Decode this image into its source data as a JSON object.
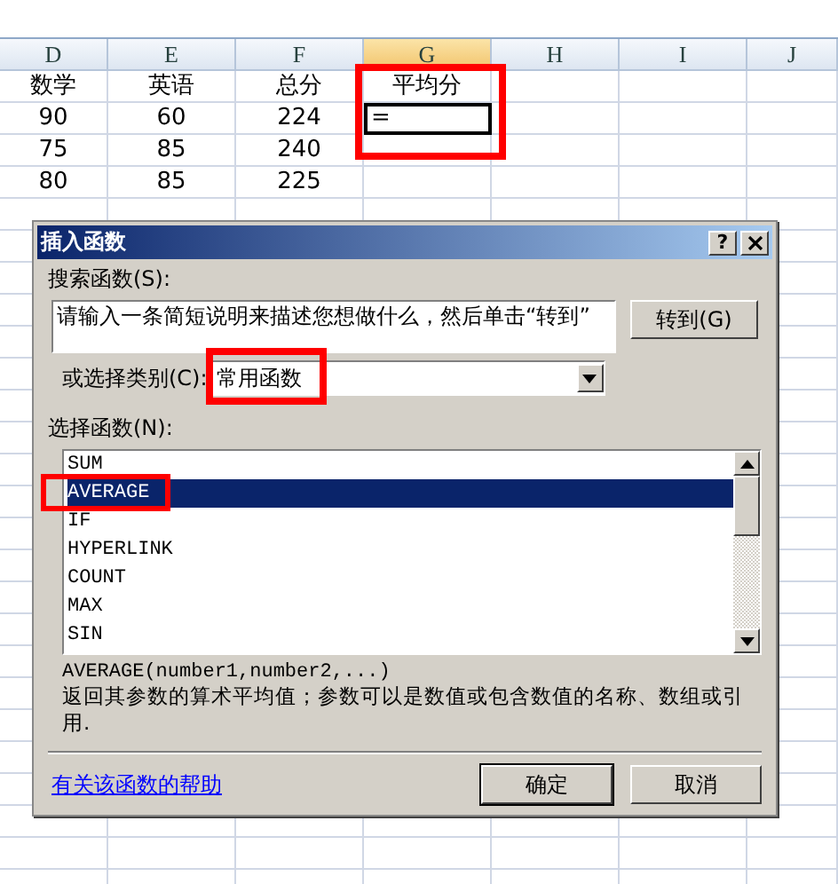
{
  "sheet": {
    "columns": [
      {
        "label": "D",
        "selected": false
      },
      {
        "label": "E",
        "selected": false
      },
      {
        "label": "F",
        "selected": false
      },
      {
        "label": "G",
        "selected": true
      },
      {
        "label": "H",
        "selected": false
      },
      {
        "label": "I",
        "selected": false
      },
      {
        "label": "J",
        "selected": false
      }
    ],
    "rows": [
      {
        "cells": [
          {
            "text": "数学",
            "selected": false
          },
          {
            "text": "英语",
            "selected": false
          },
          {
            "text": "总分",
            "selected": false
          },
          {
            "text": "平均分",
            "selected": false
          }
        ]
      },
      {
        "cells": [
          {
            "text": "90",
            "selected": false
          },
          {
            "text": "60",
            "selected": false
          },
          {
            "text": "224",
            "selected": false
          },
          {
            "text": "=",
            "selected": true
          }
        ]
      },
      {
        "cells": [
          {
            "text": "75",
            "selected": false
          },
          {
            "text": "85",
            "selected": false
          },
          {
            "text": "240",
            "selected": false
          }
        ]
      },
      {
        "cells": [
          {
            "text": "80",
            "selected": false
          },
          {
            "text": "85",
            "selected": false
          },
          {
            "text": "225",
            "selected": false
          }
        ]
      }
    ]
  },
  "dialog": {
    "title": "插入函数",
    "help_button": "?",
    "search_label": "搜索函数(S):",
    "search_field": {
      "value": "请输入一条简短说明来描述您想做什么，然后单击“转到”"
    },
    "go_button": "转到(G)",
    "category_label": "或选择类别(C):",
    "category": {
      "value": "常用函数"
    },
    "function_label": "选择函数(N):",
    "functions": [
      {
        "name": "SUM",
        "selected": false
      },
      {
        "name": "AVERAGE",
        "selected": true
      },
      {
        "name": "IF",
        "selected": false
      },
      {
        "name": "HYPERLINK",
        "selected": false
      },
      {
        "name": "COUNT",
        "selected": false
      },
      {
        "name": "MAX",
        "selected": false
      },
      {
        "name": "SIN",
        "selected": false
      }
    ],
    "syntax": "AVERAGE(number1,number2,...)",
    "description": "返回其参数的算术平均值；参数可以是数值或包含数值的名称、数组或引用.",
    "help_link": "有关该函数的帮助",
    "ok_button": "确定",
    "cancel_button": "取消"
  }
}
